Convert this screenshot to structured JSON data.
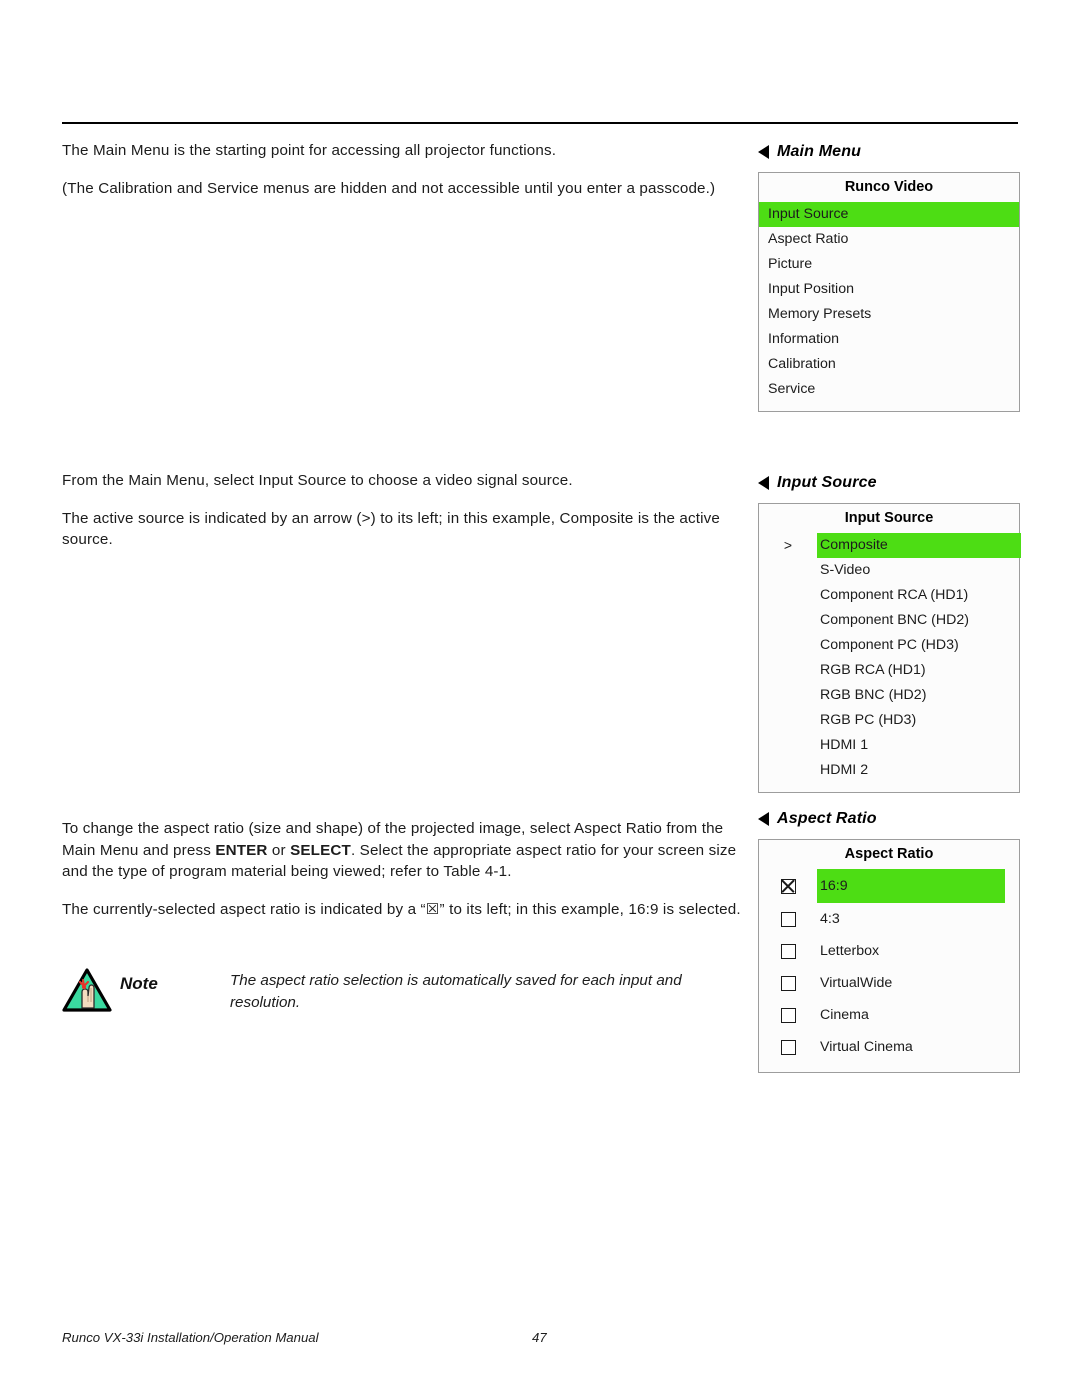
{
  "body": {
    "paragraphs_block1": [
      "The Main Menu is the starting point for accessing all projector functions.",
      "(The Calibration and Service menus are hidden and not accessible until you enter a passcode.)"
    ],
    "paragraphs_block2": [
      "From the Main Menu, select Input Source to choose a video signal source.",
      "The active source is indicated by an arrow (>) to its left; in this example, Composite is the active source."
    ],
    "block3_p1_a": "To change the aspect ratio (size and shape) of the projected image, select Aspect Ratio from the Main Menu and press ",
    "block3_p1_b": "ENTER",
    "block3_p1_c": " or ",
    "block3_p1_d": "SELECT",
    "block3_p1_e": ". Select the appropriate aspect ratio for your screen size and the type of program material being viewed; refer to Table 4-1.",
    "block3_p2": "The currently-selected aspect ratio is indicated by a “☒” to its left; in this example, 16:9 is selected."
  },
  "note": {
    "label": "Note",
    "text": "The aspect ratio selection is automatically saved for each input and resolution."
  },
  "osd": {
    "main_menu": {
      "heading": "Main Menu",
      "title": "Runco Video",
      "items": [
        {
          "label": "Input Source",
          "selected": true
        },
        {
          "label": "Aspect Ratio",
          "selected": false
        },
        {
          "label": "Picture",
          "selected": false
        },
        {
          "label": "Input Position",
          "selected": false
        },
        {
          "label": "Memory Presets",
          "selected": false
        },
        {
          "label": "Information",
          "selected": false
        },
        {
          "label": "Calibration",
          "selected": false
        },
        {
          "label": "Service",
          "selected": false
        }
      ]
    },
    "input_source": {
      "heading": "Input Source",
      "title": "Input Source",
      "active_marker": ">",
      "items": [
        {
          "label": "Composite",
          "marker": ">",
          "selected": true
        },
        {
          "label": "S-Video",
          "marker": "",
          "selected": false
        },
        {
          "label": "Component RCA (HD1)",
          "marker": "",
          "selected": false
        },
        {
          "label": "Component BNC (HD2)",
          "marker": "",
          "selected": false
        },
        {
          "label": "Component PC (HD3)",
          "marker": "",
          "selected": false
        },
        {
          "label": "RGB RCA (HD1)",
          "marker": "",
          "selected": false
        },
        {
          "label": "RGB BNC (HD2)",
          "marker": "",
          "selected": false
        },
        {
          "label": "RGB PC (HD3)",
          "marker": "",
          "selected": false
        },
        {
          "label": "HDMI 1",
          "marker": "",
          "selected": false
        },
        {
          "label": "HDMI 2",
          "marker": "",
          "selected": false
        }
      ]
    },
    "aspect_ratio": {
      "heading": "Aspect Ratio",
      "title": "Aspect Ratio",
      "items": [
        {
          "label": "16:9",
          "checked": true,
          "selected": true
        },
        {
          "label": "4:3",
          "checked": false,
          "selected": false
        },
        {
          "label": "Letterbox",
          "checked": false,
          "selected": false
        },
        {
          "label": "VirtualWide",
          "checked": false,
          "selected": false
        },
        {
          "label": "Cinema",
          "checked": false,
          "selected": false
        },
        {
          "label": "Virtual Cinema",
          "checked": false,
          "selected": false
        }
      ]
    },
    "highlight_color": "#4DDD14"
  },
  "footer": {
    "manual": "Runco VX-33i Installation/Operation Manual",
    "page": "47"
  }
}
